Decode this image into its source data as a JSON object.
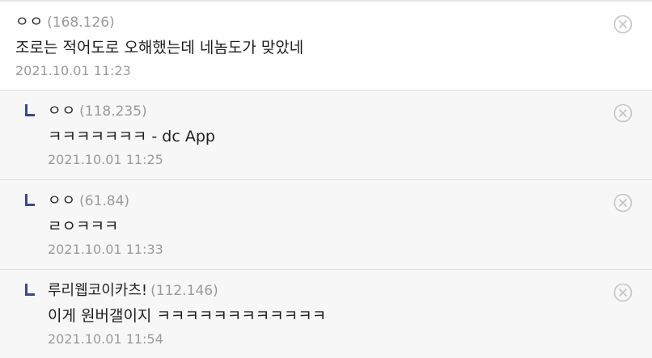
{
  "comments": [
    {
      "nickname": "ㅇㅇ",
      "ip": "(168.126)",
      "text": "조로는 적어도로 오해했는데 네놈도가 맞았네",
      "date": "2021.10.01 11:23",
      "icon": "close-circle-icon"
    },
    {
      "nickname": "ㅇㅇ",
      "ip": "(118.235)",
      "text": "ㅋㅋㅋㅋㅋㅋㅋ - dc App",
      "date": "2021.10.01 11:25",
      "icon": "close-circle-icon"
    },
    {
      "nickname": "ㅇㅇ",
      "ip": "(61.84)",
      "text": "ㄹㅇㅋㅋㅋ",
      "date": "2021.10.01 11:33",
      "icon": "close-circle-icon"
    },
    {
      "nickname": "루리웹코이카츠!",
      "ip": "(112.146)",
      "text": "이게 원버갤이지 ㅋㅋㅋㅋㅋㅋㅋㅋㅋㅋㅋㅋ",
      "date": "2021.10.01 11:54",
      "icon": "close-circle-icon"
    }
  ],
  "colors": {
    "reply_marker": "#3b4890",
    "reply_background": "#f7f7f7",
    "meta_gray": "#9a9a9a"
  }
}
